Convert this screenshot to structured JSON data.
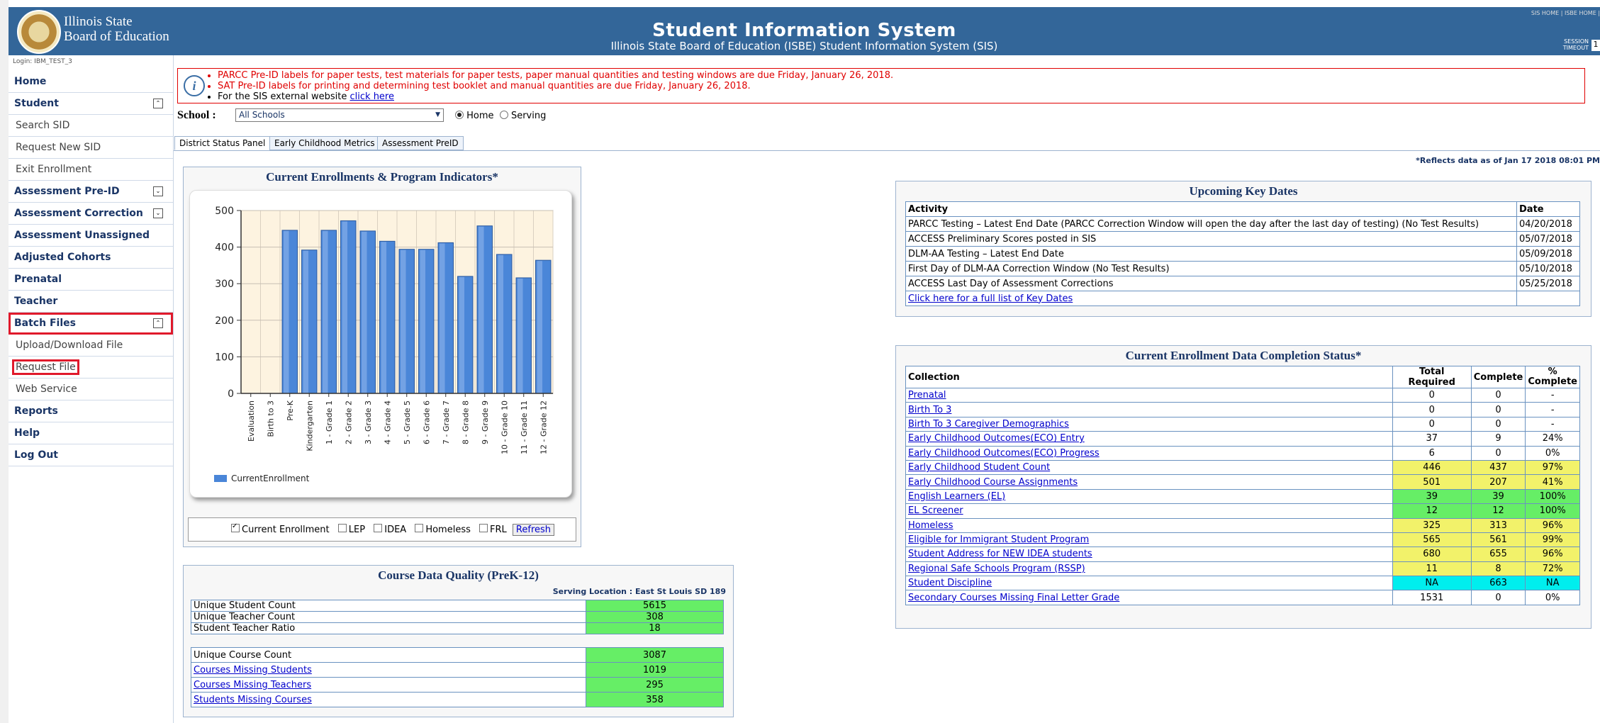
{
  "header": {
    "logo_line1": "Illinois State",
    "logo_line2": "Board of Education",
    "title": "Student Information System",
    "subtitle": "Illinois State Board of Education (ISBE) Student Information System (SIS)",
    "top_links": "SIS HOME  |  ISBE HOME  |",
    "session_label_1": "SESSION",
    "session_label_2": "TIMEOUT",
    "session_value": "1"
  },
  "sidebar": {
    "login": "Login: IBM_TEST_3",
    "items": [
      {
        "label": "Home"
      },
      {
        "label": "Student"
      },
      {
        "label": "Search SID"
      },
      {
        "label": "Request New SID"
      },
      {
        "label": "Exit Enrollment"
      },
      {
        "label": "Assessment Pre-ID"
      },
      {
        "label": "Assessment Correction"
      },
      {
        "label": "Assessment Unassigned"
      },
      {
        "label": "Adjusted Cohorts"
      },
      {
        "label": "Prenatal"
      },
      {
        "label": "Teacher"
      },
      {
        "label": "Batch Files"
      },
      {
        "label": "Upload/Download File"
      },
      {
        "label": "Request File"
      },
      {
        "label": "Web Service"
      },
      {
        "label": "Reports"
      },
      {
        "label": "Help"
      },
      {
        "label": "Log Out"
      }
    ]
  },
  "alert": {
    "line1": "PARCC Pre-ID labels for paper tests, test materials for paper tests, paper manual quantities and testing windows are due Friday, January 26, 2018.",
    "line2": "SAT Pre-ID labels for printing and determining test booklet and manual quantities are due Friday, January 26, 2018.",
    "line3_text": "For the SIS external website ",
    "line3_link": "click here"
  },
  "school": {
    "label": "School :",
    "selected": "All Schools",
    "radio_home": "Home",
    "radio_serving": "Serving"
  },
  "tabs": [
    "District Status Panel",
    "Early Childhood Metrics",
    "Assessment PreID"
  ],
  "reflects": "*Reflects data as of Jan 17 2018 08:01 PM",
  "chart_panel": {
    "title": "Current Enrollments & Program Indicators*",
    "controls": {
      "current_enrollment": "Current Enrollment",
      "lep": "LEP",
      "idea": "IDEA",
      "homeless": "Homeless",
      "frl": "FRL",
      "refresh": "Refresh"
    }
  },
  "chart_data": {
    "type": "bar",
    "categories": [
      "Evaluation",
      "Birth to 3",
      "Pre-K",
      "Kindergarten",
      "1 - Grade 1",
      "2 - Grade 2",
      "3 - Grade 3",
      "4 - Grade 4",
      "5 - Grade 5",
      "6 - Grade 6",
      "7 - Grade 7",
      "8 - Grade 8",
      "9 - Grade 9",
      "10 - Grade 10",
      "11 - Grade 11",
      "12 - Grade 12"
    ],
    "series": [
      {
        "name": "CurrentEnrollment",
        "values": [
          0,
          0,
          446,
          392,
          446,
          472,
          444,
          416,
          394,
          394,
          412,
          320,
          458,
          380,
          316,
          364
        ]
      }
    ],
    "ylim": [
      0,
      500
    ],
    "yticks": [
      0,
      100,
      200,
      300,
      400,
      500
    ],
    "grid": true,
    "legend": "bottom-left",
    "bar_color": "#4a86d8"
  },
  "course_quality": {
    "title": "Course Data Quality (PreK-12)",
    "serving": "Serving Location : East St Louis SD 189",
    "rows1": [
      {
        "label": "Unique Student Count",
        "value": "5615"
      },
      {
        "label": "Unique Teacher Count",
        "value": "308"
      },
      {
        "label": "Student Teacher Ratio",
        "value": "18"
      }
    ],
    "rows2": [
      {
        "label": "Unique Course Count",
        "value": "3087",
        "link": false
      },
      {
        "label": "Courses Missing Students",
        "value": "1019",
        "link": true
      },
      {
        "label": "Courses Missing Teachers",
        "value": "295",
        "link": true
      },
      {
        "label": "Students Missing Courses",
        "value": "358",
        "link": true
      }
    ]
  },
  "key_dates": {
    "title": "Upcoming Key Dates",
    "col_activity": "Activity",
    "col_date": "Date",
    "rows": [
      {
        "activity": "PARCC Testing – Latest End Date (PARCC Correction Window will open the day after the last day of testing) (No Test Results)",
        "date": "04/20/2018"
      },
      {
        "activity": "ACCESS Preliminary Scores posted in SIS",
        "date": "05/07/2018"
      },
      {
        "activity": "DLM-AA Testing – Latest End Date",
        "date": "05/09/2018"
      },
      {
        "activity": "First Day of DLM-AA Correction Window (No Test Results)",
        "date": "05/10/2018"
      },
      {
        "activity": "ACCESS Last Day of Assessment Corrections",
        "date": "05/25/2018"
      }
    ],
    "full_list_link": "Click here for a full list of Key Dates"
  },
  "completion": {
    "title": "Current Enrollment Data Completion Status*",
    "col_collection": "Collection",
    "col_total": "Total Required",
    "col_complete": "Complete",
    "col_pct_1": "%",
    "col_pct_2": "Complete",
    "rows": [
      {
        "collection": "Prenatal",
        "total": "0",
        "complete": "0",
        "pct": "-",
        "status": "none"
      },
      {
        "collection": "Birth To 3",
        "total": "0",
        "complete": "0",
        "pct": "-",
        "status": "none"
      },
      {
        "collection": "Birth To 3 Caregiver Demographics",
        "total": "0",
        "complete": "0",
        "pct": "-",
        "status": "none"
      },
      {
        "collection": "Early Childhood Outcomes(ECO) Entry",
        "total": "37",
        "complete": "9",
        "pct": "24%",
        "status": "none"
      },
      {
        "collection": "Early Childhood Outcomes(ECO) Progress",
        "total": "6",
        "complete": "0",
        "pct": "0%",
        "status": "none"
      },
      {
        "collection": "Early Childhood Student Count",
        "total": "446",
        "complete": "437",
        "pct": "97%",
        "status": "yellow"
      },
      {
        "collection": "Early Childhood Course Assignments",
        "total": "501",
        "complete": "207",
        "pct": "41%",
        "status": "yellow"
      },
      {
        "collection": "English Learners (EL)",
        "total": "39",
        "complete": "39",
        "pct": "100%",
        "status": "lime"
      },
      {
        "collection": "EL Screener",
        "total": "12",
        "complete": "12",
        "pct": "100%",
        "status": "lime"
      },
      {
        "collection": "Homeless",
        "total": "325",
        "complete": "313",
        "pct": "96%",
        "status": "yellow"
      },
      {
        "collection": "Eligible for Immigrant Student Program",
        "total": "565",
        "complete": "561",
        "pct": "99%",
        "status": "yellow"
      },
      {
        "collection": "Student Address for NEW IDEA students",
        "total": "680",
        "complete": "655",
        "pct": "96%",
        "status": "yellow"
      },
      {
        "collection": "Regional Safe Schools Program (RSSP)",
        "total": "11",
        "complete": "8",
        "pct": "72%",
        "status": "yellow"
      },
      {
        "collection": "Student Discipline",
        "total": "NA",
        "complete": "663",
        "pct": "NA",
        "status": "cyan"
      },
      {
        "collection": "Secondary Courses Missing Final Letter Grade",
        "total": "1531",
        "complete": "0",
        "pct": "0%",
        "status": "none"
      }
    ]
  }
}
